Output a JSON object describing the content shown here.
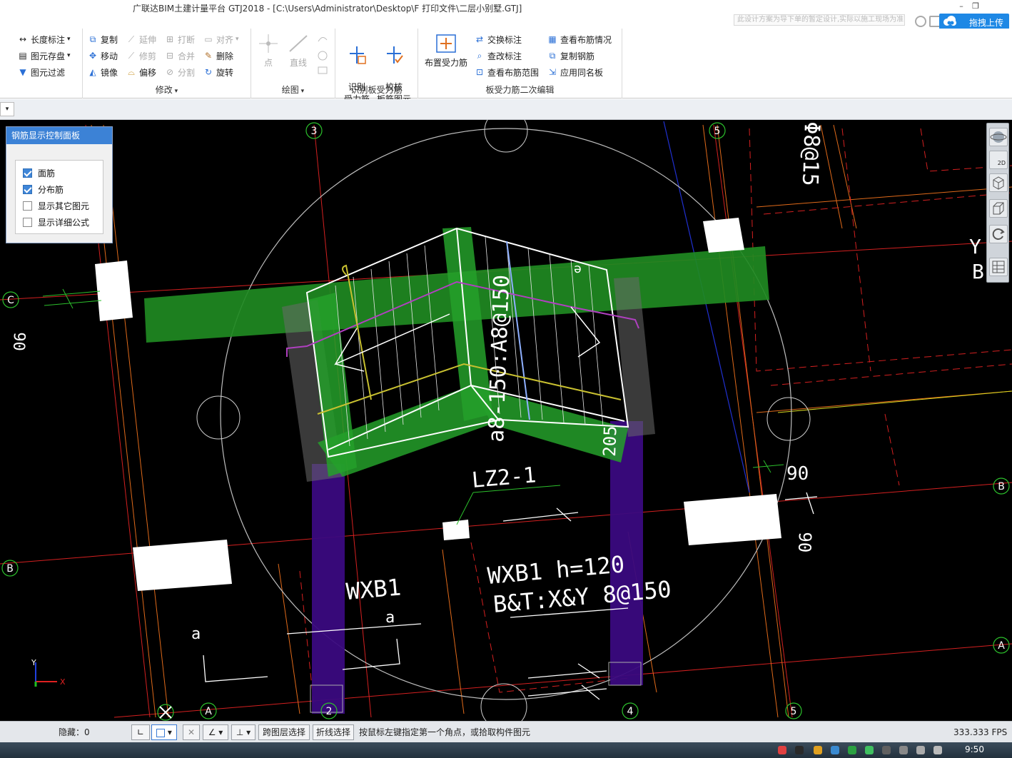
{
  "app": {
    "title": "广联达BIM土建计量平台 GTJ2018 - [C:\\Users\\Administrator\\Desktop\\F 打印文件\\二层小别墅.GTJ]",
    "notification": "此设计方案为导下单的暂定设计,实际以施工现场为准...",
    "upload_label": "拖拽上传",
    "win_controls": {
      "minimize": "–",
      "restore": "❐"
    }
  },
  "ribbon": {
    "group_left": {
      "items": [
        {
          "label": "长度标注",
          "icon": "dimension-icon"
        },
        {
          "label": "图元存盘",
          "icon": "save-element-icon"
        },
        {
          "label": "图元过滤",
          "icon": "filter-icon"
        }
      ]
    },
    "group_modify": {
      "label": "修改",
      "col1": [
        {
          "label": "复制",
          "icon": "copy-icon"
        },
        {
          "label": "移动",
          "icon": "move-icon"
        },
        {
          "label": "镜像",
          "icon": "mirror-icon"
        }
      ],
      "col2": [
        {
          "label": "延伸",
          "icon": "extend-icon"
        },
        {
          "label": "修剪",
          "icon": "trim-icon"
        },
        {
          "label": "偏移",
          "icon": "offset-icon"
        }
      ],
      "col3": [
        {
          "label": "打断",
          "icon": "break-icon"
        },
        {
          "label": "合并",
          "icon": "merge-icon"
        },
        {
          "label": "分割",
          "icon": "split-icon"
        }
      ],
      "col4": [
        {
          "label": "对齐",
          "icon": "align-icon"
        },
        {
          "label": "删除",
          "icon": "delete-icon"
        },
        {
          "label": "旋转",
          "icon": "rotate-icon"
        }
      ]
    },
    "group_draw": {
      "label": "绘图",
      "point": "点",
      "line": "直线"
    },
    "group_identify": {
      "label": "识别板受力筋",
      "identify": "识别\n受力筋",
      "check": "校核\n板筋图元"
    },
    "group_edit": {
      "label": "板受力筋二次编辑",
      "place": "布置受力筋",
      "col1": [
        {
          "label": "交换标注",
          "icon": "swap-annotation-icon"
        },
        {
          "label": "查改标注",
          "icon": "edit-annotation-icon"
        },
        {
          "label": "查看布筋范围",
          "icon": "view-range-icon"
        }
      ],
      "col2": [
        {
          "label": "查看布筋情况",
          "icon": "view-layout-icon"
        },
        {
          "label": "复制钢筋",
          "icon": "copy-rebar-icon"
        },
        {
          "label": "应用同名板",
          "icon": "apply-same-icon"
        }
      ]
    }
  },
  "panel": {
    "title": "钢筋显示控制面板",
    "options": [
      {
        "label": "面筋",
        "checked": true
      },
      {
        "label": "分布筋",
        "checked": true
      },
      {
        "label": "显示其它图元",
        "checked": false
      },
      {
        "label": "显示详细公式",
        "checked": false
      }
    ]
  },
  "viewtools": {
    "mode_2d": "2D"
  },
  "cad": {
    "axis": [
      "3",
      "5",
      "C",
      "B",
      "A",
      "A",
      "B",
      "2",
      "4",
      "5",
      "A"
    ],
    "rebar_label": "a8-150:A8@150",
    "dim_90_left": "90",
    "dim_90_right": "90",
    "dim_90_right2": "90",
    "dim_205": "205",
    "rebar_top_right": "Φ8@15",
    "column_label": "LZ2-1",
    "slab_left": "WXB1",
    "slab_right_line1": "WXB1 h=120",
    "slab_right_line2": "B&T:X&Y 8@150",
    "small_a1": "a",
    "small_a2": "a",
    "edge_Y": "Y",
    "edge_B": "B",
    "coord_x": "X",
    "coord_y": "Y"
  },
  "status": {
    "hidden": "隐藏：0",
    "cross_layer": "跨图层选择",
    "polyline": "折线选择",
    "hint": "按鼠标左键指定第一个角点，或拾取构件图元",
    "fps": "333.333 FPS"
  },
  "taskbar": {
    "time": "9:50"
  }
}
